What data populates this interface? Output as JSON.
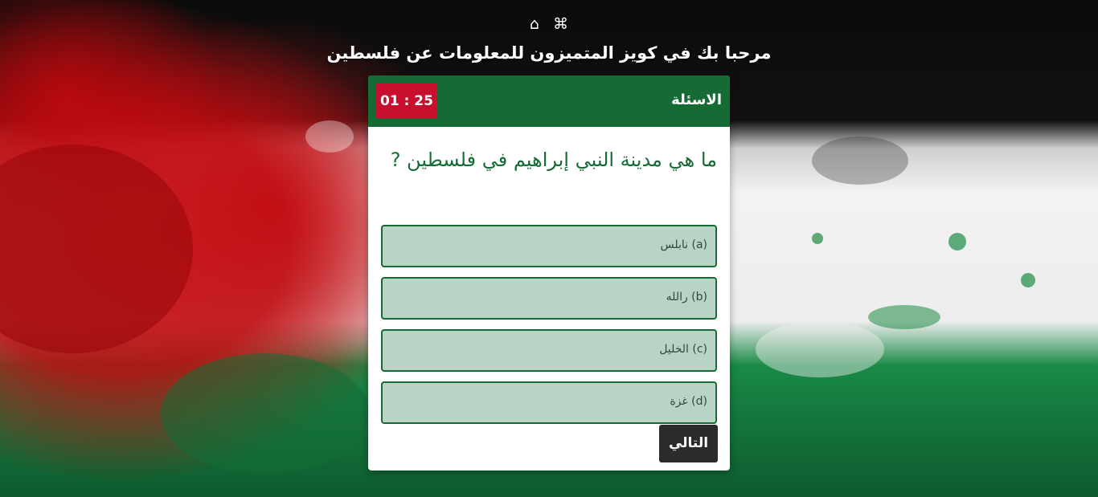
{
  "header": {
    "icons": [
      "home-icon",
      "command-icon"
    ],
    "home_glyph": "⌂",
    "command_glyph": "⌘",
    "title": "مرحبا بك في كويز المتميزون للمعلومات عن فلسطين"
  },
  "card": {
    "header_title": "الاسئلة",
    "timer": "01 : 25",
    "question": "ما هي مدينة النبي إبراهيم في فلسطين ?",
    "options": [
      "(a) نابلس",
      "(b) رالله",
      "(c) الخليل",
      "(d) غزة"
    ],
    "next_label": "التالي"
  },
  "colors": {
    "primary_green": "#166b34",
    "timer_red": "#c8102e",
    "option_bg": "#b9d4c4",
    "next_bg": "#2b2b2b"
  }
}
